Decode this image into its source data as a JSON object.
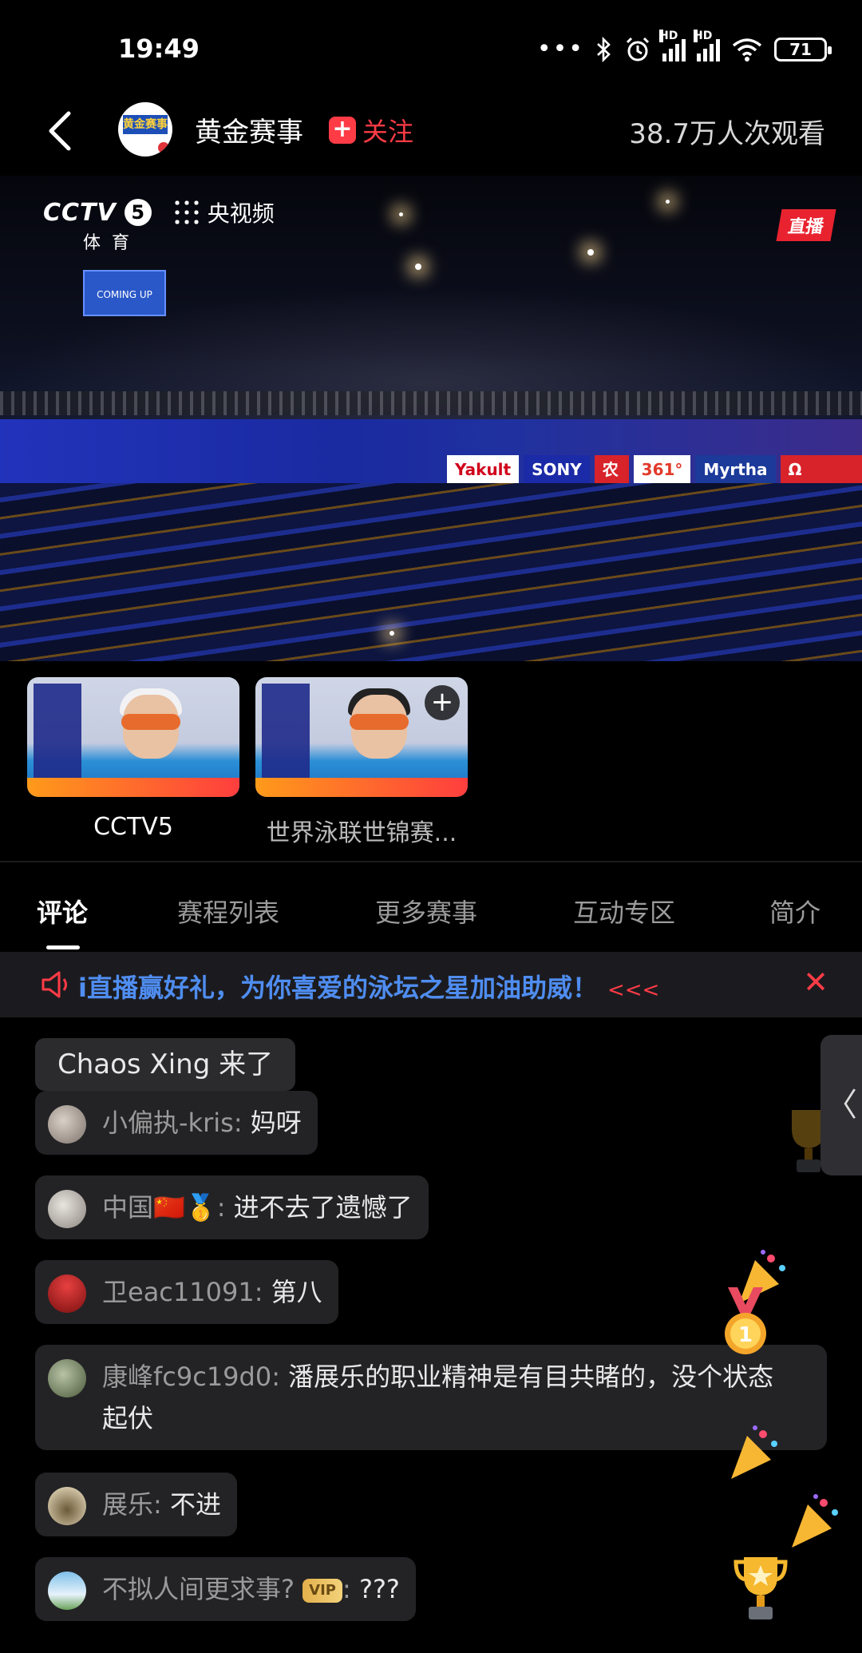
{
  "status_bar": {
    "time": "19:49",
    "battery": "71",
    "icons": [
      "more-dots-icon",
      "bluetooth-icon",
      "alarm-icon",
      "signal-hd-icon",
      "signal-hd-icon",
      "wifi-icon",
      "battery-icon"
    ],
    "hd_label": "HD"
  },
  "header": {
    "channel_name": "黄金赛事",
    "follow_label": "关注",
    "view_count": "38.7万人次观看",
    "logo_text": "黄金赛事"
  },
  "video": {
    "channel_logo": "CCTV",
    "channel_number": "5",
    "channel_sub": "体育",
    "platform_name": "央视频",
    "live_label": "直播",
    "scoreboard_text": "COMING UP",
    "sponsors": [
      "Yakult",
      "SONY",
      "农夫山泉",
      "361°",
      "Myrtha Pools",
      "Ω OMEGA"
    ]
  },
  "thumbnails": [
    {
      "caption": "CCTV5",
      "active": true
    },
    {
      "caption": "世界泳联世锦赛...",
      "active": false
    }
  ],
  "tabs": [
    {
      "label": "评论",
      "active": true
    },
    {
      "label": "赛程列表",
      "active": false
    },
    {
      "label": "更多赛事",
      "active": false
    },
    {
      "label": "互动专区",
      "active": false
    },
    {
      "label": "简介",
      "active": false
    }
  ],
  "promo": {
    "text": "i直播赢好礼，为你喜爱的泳坛之星加油助威！",
    "arrows": "<<<"
  },
  "chat": {
    "join_message": "Chaos Xing 来了",
    "comments": [
      {
        "user": "小偏执-kris",
        "sep": ": ",
        "text": "妈呀"
      },
      {
        "user": "中国🇨🇳🥇",
        "sep": ": ",
        "text": "进不去了遗憾了"
      },
      {
        "user": "卫eac11091",
        "sep": ": ",
        "text": "第八"
      },
      {
        "user": "康峰fc9c19d0",
        "sep": ": ",
        "text": "潘展乐的职业精神是有目共睹的，没个状态起伏"
      },
      {
        "user": "展乐",
        "sep": ": ",
        "text": "不进"
      },
      {
        "user": "不拟人间更求事?",
        "badge": "VIP",
        "sep": ": ",
        "text": "???"
      }
    ]
  },
  "side_tab": {
    "label": "〈"
  },
  "colors": {
    "accent_red": "#ff3b46",
    "promo_blue": "#4f8df0",
    "background": "#000000"
  }
}
